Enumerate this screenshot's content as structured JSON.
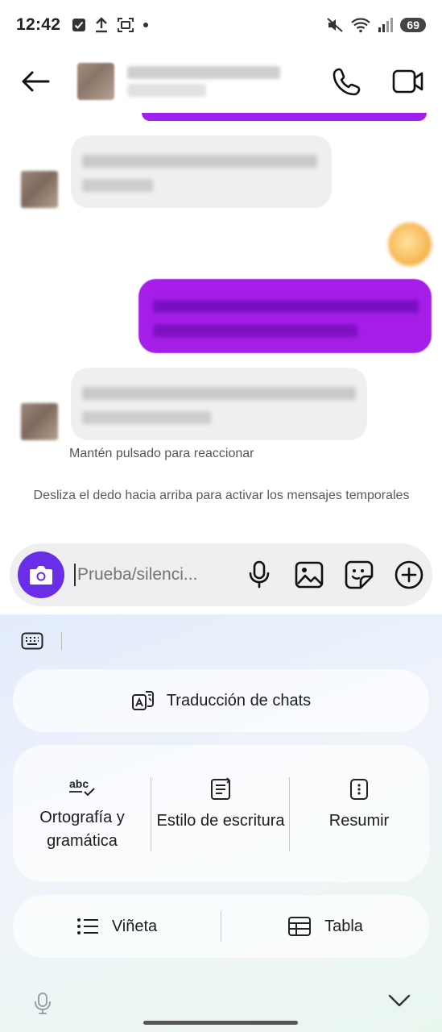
{
  "status": {
    "time": "12:42",
    "battery": "69",
    "left_icons": [
      "checkbox-icon",
      "upload-icon",
      "screen-capture-icon",
      "dot-icon"
    ],
    "right_icons": [
      "mute-icon",
      "wifi-icon",
      "signal-icon"
    ]
  },
  "header": {
    "icons": [
      "back-arrow-icon",
      "phone-icon",
      "video-camera-icon"
    ]
  },
  "chat": {
    "hold_hint": "Mantén pulsado para reaccionar",
    "ephemeral_hint": "Desliza el dedo hacia arriba para activar los mensajes temporales"
  },
  "composer": {
    "placeholder": "Prueba/silenci...",
    "icons": [
      "camera-icon",
      "microphone-icon",
      "image-icon",
      "sticker-icon",
      "plus-circle-icon"
    ]
  },
  "ai_panel": {
    "translate_label": "Traducción de chats",
    "tools": [
      {
        "label": "Ortografía y gramática",
        "icon": "spellcheck-icon"
      },
      {
        "label": "Estilo de escritura",
        "icon": "writing-style-icon"
      },
      {
        "label": "Resumir",
        "icon": "summarize-icon"
      }
    ],
    "format": [
      {
        "label": "Viñeta",
        "icon": "bullet-list-icon"
      },
      {
        "label": "Tabla",
        "icon": "table-icon"
      }
    ]
  },
  "colors": {
    "accent_purple": "#a51ee8",
    "camera_button": "#6a2ee8"
  }
}
